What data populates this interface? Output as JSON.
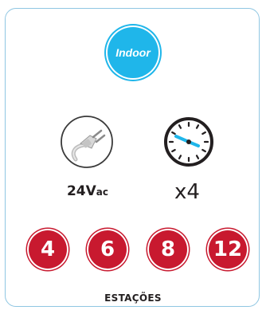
{
  "badge": {
    "label": "Indoor",
    "color": "#1fb6ea"
  },
  "power": {
    "value": "24V",
    "unit": "ac",
    "icon": "power-plug-icon"
  },
  "timer": {
    "multiplier": "x4",
    "icon": "clock-icon",
    "accent": "#1fb6ea"
  },
  "stations": {
    "options": [
      "4",
      "6",
      "8",
      "12"
    ],
    "color": "#c8192f",
    "label": "ESTAÇÕES"
  }
}
